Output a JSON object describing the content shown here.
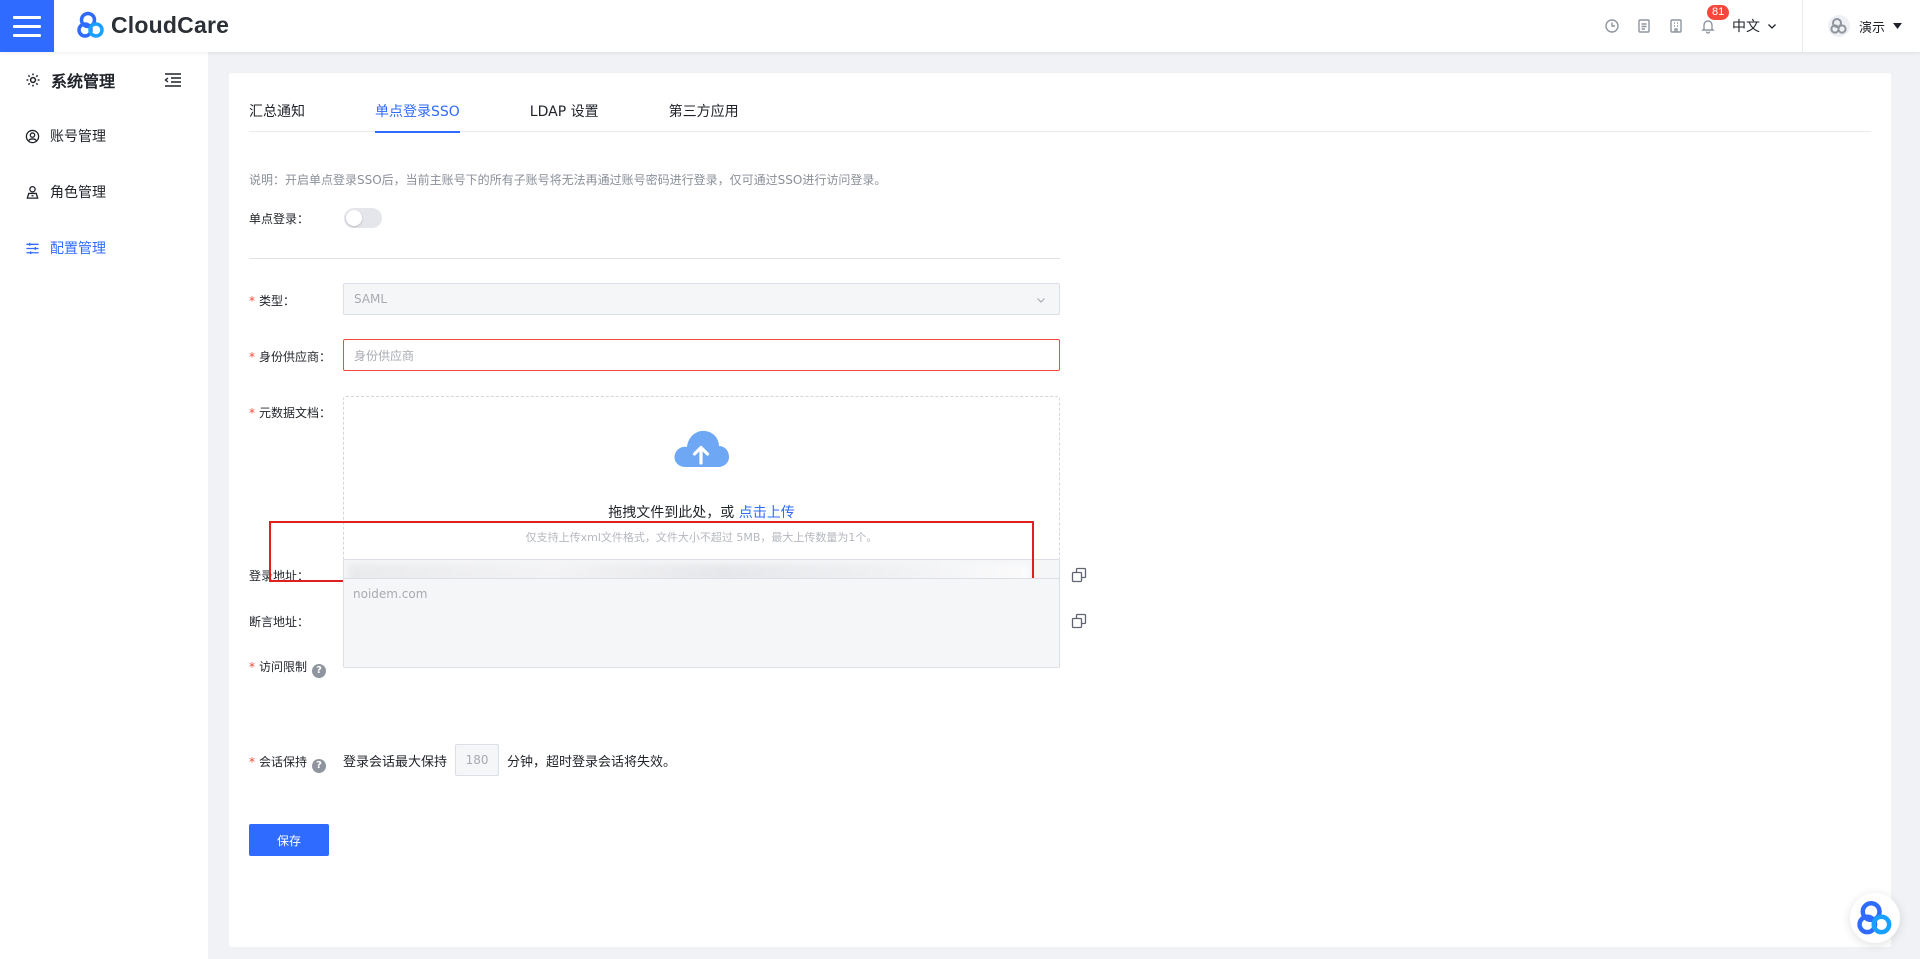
{
  "app": {
    "brand": "CloudCare",
    "accent_color": "#2f6bff"
  },
  "topbar": {
    "icons": [
      "history-icon",
      "document-icon",
      "building-icon",
      "bell-icon"
    ],
    "notification_count": "81",
    "language": "中文",
    "user_name": "演示"
  },
  "sidebar": {
    "title": "系统管理",
    "items": [
      {
        "label": "账号管理",
        "icon": "user-circle-icon",
        "active": false
      },
      {
        "label": "角色管理",
        "icon": "role-icon",
        "active": false
      },
      {
        "label": "配置管理",
        "icon": "settings-sliders-icon",
        "active": true
      }
    ]
  },
  "tabs": [
    {
      "label": "汇总通知",
      "active": false
    },
    {
      "label": "单点登录SSO",
      "active": true
    },
    {
      "label": "LDAP 设置",
      "active": false
    },
    {
      "label": "第三方应用",
      "active": false
    }
  ],
  "form": {
    "note": "说明：开启单点登录SSO后，当前主账号下的所有子账号将无法再通过账号密码进行登录，仅可通过SSO进行访问登录。",
    "sso_label": "单点登录：",
    "sso_enabled": false,
    "type_label": "类型：",
    "type_value": "SAML",
    "idp_label": "身份供应商：",
    "idp_placeholder": "身份供应商",
    "metadata_label": "元数据文档：",
    "upload_text": "拖拽文件到此处，或",
    "upload_link": "点击上传",
    "upload_hint": "仅支持上传xml文件格式，文件大小不超过 5MB，最大上传数量为1个。",
    "login_url_label": "登录地址：",
    "assertion_url_label": "断言地址：",
    "access_label": "访问限制",
    "access_placeholder": "noidem.com",
    "session_label": "会话保持",
    "session_prefix": "登录会话最大保持",
    "session_minutes": "180",
    "session_suffix": "分钟，超时登录会话将失效。",
    "save_label": "保存"
  }
}
